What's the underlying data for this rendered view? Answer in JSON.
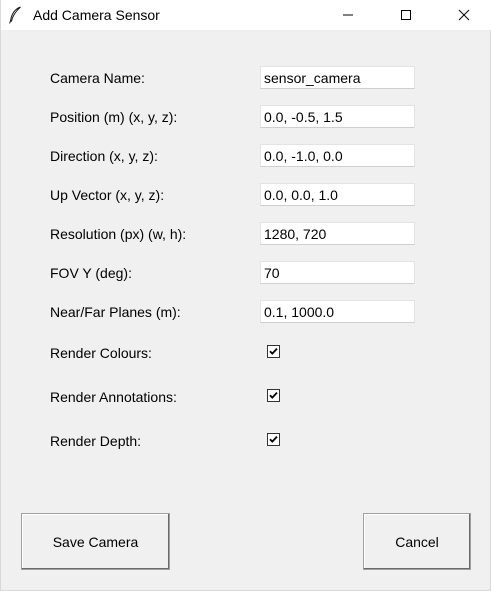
{
  "window": {
    "title": "Add Camera Sensor",
    "icon": "feather-icon"
  },
  "titlebar_controls": [
    "minimize-icon",
    "maximize-icon",
    "close-icon"
  ],
  "fields": [
    {
      "label": "Camera Name:",
      "value": "sensor_camera"
    },
    {
      "label": "Position (m) (x, y, z):",
      "value": "0.0, -0.5, 1.5"
    },
    {
      "label": "Direction (x, y, z):",
      "value": "0.0, -1.0, 0.0"
    },
    {
      "label": "Up Vector (x, y, z):",
      "value": "0.0, 0.0, 1.0"
    },
    {
      "label": "Resolution (px) (w, h):",
      "value": "1280, 720"
    },
    {
      "label": "FOV Y (deg):",
      "value": "70"
    },
    {
      "label": "Near/Far Planes (m):",
      "value": "0.1, 1000.0"
    }
  ],
  "checkboxes": [
    {
      "label": "Render Colours:",
      "checked": true
    },
    {
      "label": "Render Annotations:",
      "checked": true
    },
    {
      "label": "Render Depth:",
      "checked": true
    }
  ],
  "buttons": {
    "save_label": "Save Camera",
    "cancel_label": "Cancel"
  }
}
